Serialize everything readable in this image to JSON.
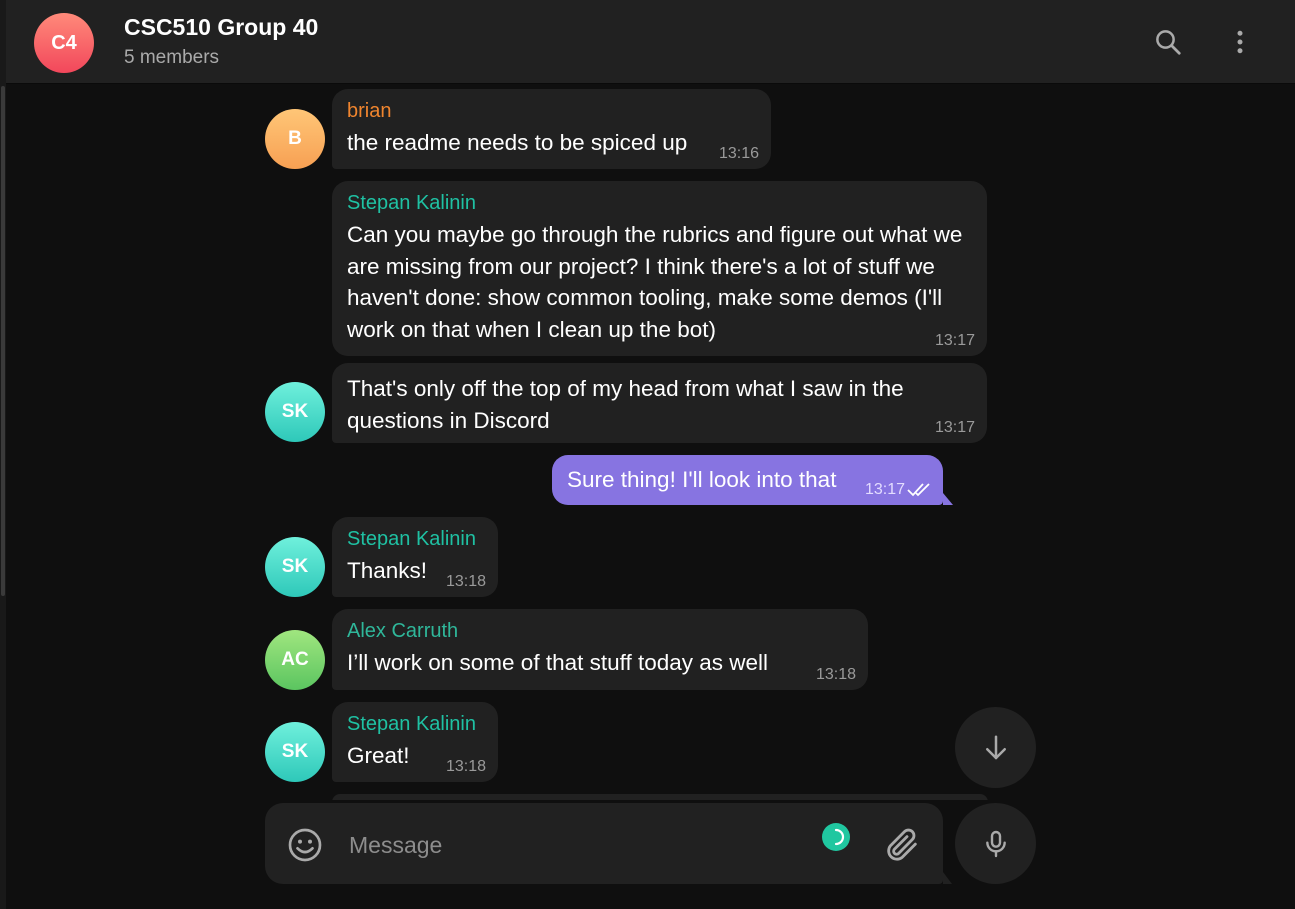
{
  "chat": {
    "avatar_initials": "C4",
    "title": "CSC510 Group 40",
    "subtitle": "5 members"
  },
  "messages": [
    {
      "sender": "brian",
      "initials": "B",
      "text": "the readme needs to be spiced up",
      "time": "13:16"
    },
    {
      "sender": "Stepan Kalinin",
      "text": "Can you maybe go through the rubrics and figure out what we are missing from our project? I think there's a lot of stuff we haven't done: show common tooling, make some demos (I'll work on that when I clean up the bot)",
      "time": "13:17"
    },
    {
      "initials": "SK",
      "text": "That's only off the top of my head from what I saw in the questions in Discord",
      "time": "13:17"
    },
    {
      "outgoing": true,
      "text": "Sure thing! I'll look into that",
      "time": "13:17",
      "status": "read"
    },
    {
      "sender": "Stepan Kalinin",
      "initials": "SK",
      "text": "Thanks!",
      "time": "13:18"
    },
    {
      "sender": "Alex Carruth",
      "initials": "AC",
      "text": "I’ll work on some of that stuff today as well",
      "time": "13:18"
    },
    {
      "sender": "Stepan Kalinin",
      "initials": "SK",
      "text": "Great!",
      "time": "13:18"
    }
  ],
  "composer": {
    "placeholder": "Message"
  },
  "icons": {
    "search": "search-icon",
    "more": "more-vertical-icon",
    "emoji": "emoji-icon",
    "attach": "paperclip-icon",
    "mic": "microphone-icon",
    "scroll_down": "arrow-down-icon",
    "read_status": "double-check-icon"
  },
  "colors": {
    "accent_outgoing": "#8774e1",
    "name_brian": "#f0852e",
    "name_stepan": "#1fc1a3",
    "name_alex": "#2fb79a"
  }
}
